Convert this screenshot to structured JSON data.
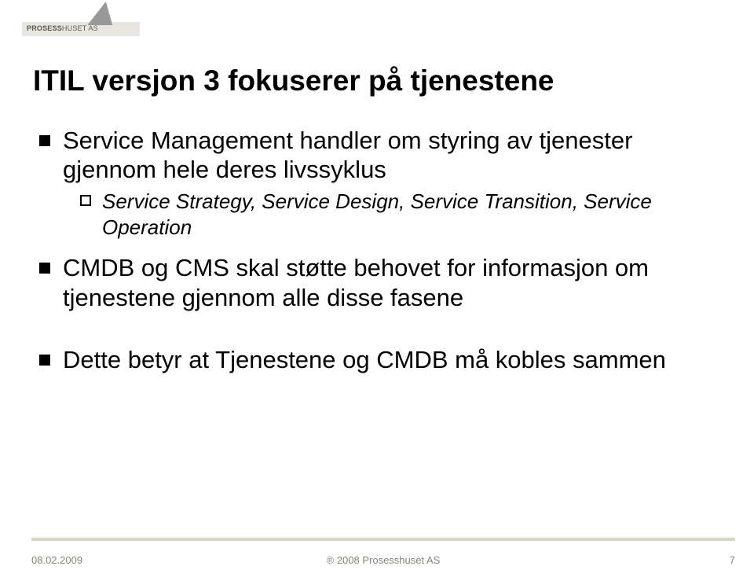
{
  "logo": {
    "brand1": "PROSESS",
    "brand2": "HUSET AS"
  },
  "title": "ITIL versjon 3 fokuserer på tjenestene",
  "bullets": [
    {
      "level": 1,
      "text": "Service Management handler om styring av tjenester gjennom hele deres livssyklus"
    },
    {
      "level": 2,
      "text": "Service Strategy, Service Design, Service Transition, Service Operation"
    },
    {
      "level": 1,
      "text": "CMDB og CMS skal støtte behovet for informasjon om tjenestene gjennom alle disse fasene"
    },
    {
      "level": 1,
      "text": "Dette betyr at Tjenestene og CMDB må kobles sammen"
    }
  ],
  "footer": {
    "date": "08.02.2009",
    "copyright": "® 2008 Prosesshuset AS",
    "page": "7"
  }
}
